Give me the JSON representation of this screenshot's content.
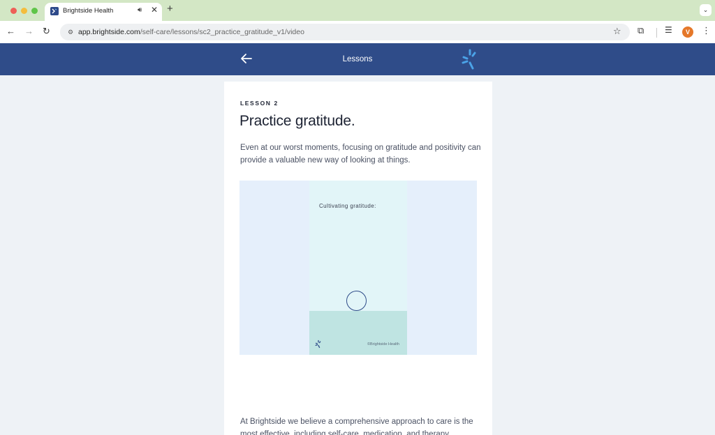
{
  "browser": {
    "tab_title": "Brightside Health",
    "tab_audio_icon": "speaker-icon",
    "tab_close": "✕",
    "new_tab": "+",
    "url_host": "app.brightside.com",
    "url_path": "/self-care/lessons/sc2_practice_gratitude_v1/video",
    "avatar_letter": "V"
  },
  "header": {
    "title": "Lessons"
  },
  "lesson": {
    "eyebrow": "LESSON 2",
    "title": "Practice gratitude.",
    "description": "Even at our worst moments, focusing on gratitude and positivity can provide a valuable new way of looking at things.",
    "video_caption": "Cultivating gratitude:",
    "video_credit": "©Brightside Health",
    "body": "At Brightside we believe a comprehensive approach to care is the most effective, including self-care, medication, and therapy."
  },
  "colors": {
    "header_bg": "#2f4c89",
    "brand_accent": "#4ba3e8",
    "tabstrip_bg": "#d3e7c5",
    "avatar_bg": "#e5782a"
  }
}
